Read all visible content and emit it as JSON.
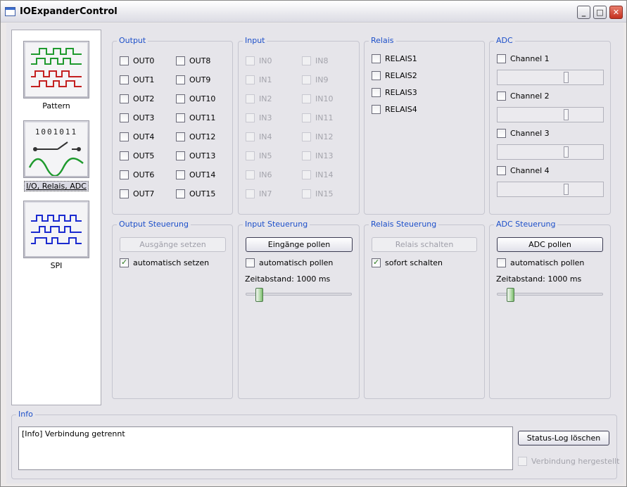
{
  "window": {
    "title": "IOExpanderControl",
    "minimize": "_",
    "maximize": "□",
    "close": "✕"
  },
  "nav": [
    {
      "label": "Pattern",
      "icon": "pattern-waveform-icon"
    },
    {
      "label": "I/O, Relais, ADC",
      "icon": "io-relay-adc-icon",
      "digits": "1001011"
    },
    {
      "label": "SPI",
      "icon": "spi-waveform-icon"
    }
  ],
  "output": {
    "title": "Output",
    "col1": [
      "OUT0",
      "OUT1",
      "OUT2",
      "OUT3",
      "OUT4",
      "OUT5",
      "OUT6",
      "OUT7"
    ],
    "col2": [
      "OUT8",
      "OUT9",
      "OUT10",
      "OUT11",
      "OUT12",
      "OUT13",
      "OUT14",
      "OUT15"
    ]
  },
  "input": {
    "title": "Input",
    "col1": [
      "IN0",
      "IN1",
      "IN2",
      "IN3",
      "IN4",
      "IN5",
      "IN6",
      "IN7"
    ],
    "col2": [
      "IN8",
      "IN9",
      "IN10",
      "IN11",
      "IN12",
      "IN13",
      "IN14",
      "IN15"
    ]
  },
  "relais": {
    "title": "Relais",
    "items": [
      "RELAIS1",
      "RELAIS2",
      "RELAIS3",
      "RELAIS4"
    ]
  },
  "adc": {
    "title": "ADC",
    "channels": [
      {
        "label": "Channel 1",
        "level": 0.65
      },
      {
        "label": "Channel 2",
        "level": 0.65
      },
      {
        "label": "Channel 3",
        "level": 0.65
      },
      {
        "label": "Channel 4",
        "level": 0.65
      }
    ]
  },
  "output_ctrl": {
    "title": "Output Steuerung",
    "button": "Ausgänge setzen",
    "checkbox": "automatisch setzen",
    "checked": true
  },
  "input_ctrl": {
    "title": "Input Steuerung",
    "button": "Eingänge pollen",
    "checkbox": "automatisch pollen",
    "checked": false,
    "interval_label": "Zeitabstand: 1000 ms",
    "slider_level": 0.1
  },
  "relais_ctrl": {
    "title": "Relais Steuerung",
    "button": "Relais schalten",
    "checkbox": "sofort schalten",
    "checked": true
  },
  "adc_ctrl": {
    "title": "ADC Steuerung",
    "button": "ADC pollen",
    "checkbox": "automatisch pollen",
    "checked": false,
    "interval_label": "Zeitabstand: 1000 ms",
    "slider_level": 0.1
  },
  "info": {
    "title": "Info",
    "log": "[Info] Verbindung getrennt",
    "clear_button": "Status-Log löschen",
    "connected_label": "Verbindung hergestellt"
  },
  "colors": {
    "group_title": "#1c4fc9",
    "pattern_green": "#1f9a2e",
    "pattern_red": "#c42020",
    "spi_blue": "#1a2ad0"
  }
}
